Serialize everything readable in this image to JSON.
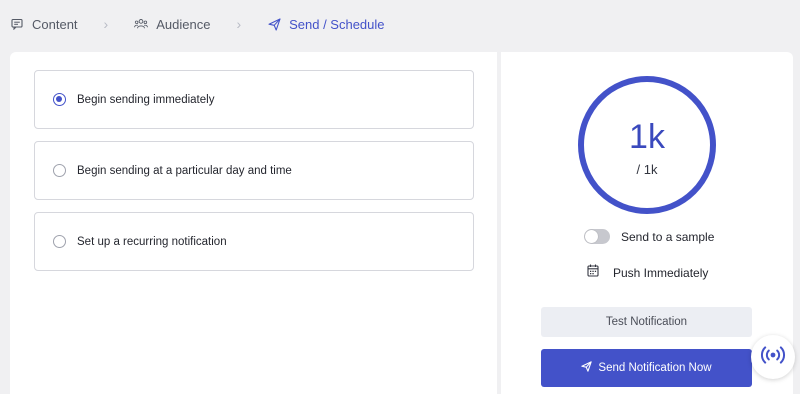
{
  "stepper": {
    "steps": [
      {
        "label": "Content",
        "icon": "chat-icon",
        "active": false
      },
      {
        "label": "Audience",
        "icon": "users-icon",
        "active": false
      },
      {
        "label": "Send / Schedule",
        "icon": "paper-plane-icon",
        "active": true
      }
    ],
    "separator_icon": "chevron-right-icon"
  },
  "schedule_options": [
    {
      "label": "Begin sending immediately",
      "selected": true
    },
    {
      "label": "Begin sending at a particular day and time",
      "selected": false
    },
    {
      "label": "Set up a recurring notification",
      "selected": false
    }
  ],
  "summary": {
    "audience_count": "1k",
    "audience_total": "/ 1k",
    "sample_toggle_label": "Send to a sample",
    "sample_toggle_on": false,
    "timing_icon": "calendar-icon",
    "timing_label": "Push Immediately"
  },
  "actions": {
    "test_label": "Test Notification",
    "send_label": "Send Notification Now",
    "send_icon": "paper-plane-icon"
  },
  "help_widget": {
    "icon": "broadcast-icon"
  },
  "colors": {
    "accent": "#4352c9",
    "background": "#f0f0f2",
    "panel": "#ffffff",
    "secondary_button": "#eceef3"
  }
}
